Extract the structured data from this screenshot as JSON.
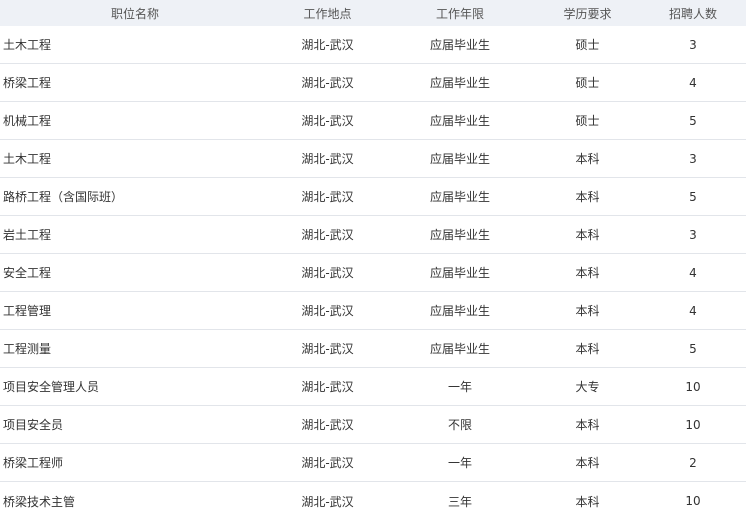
{
  "table": {
    "headers": [
      "职位名称",
      "工作地点",
      "工作年限",
      "学历要求",
      "招聘人数"
    ],
    "rows": [
      [
        "土木工程",
        "湖北-武汉",
        "应届毕业生",
        "硕士",
        "3"
      ],
      [
        "桥梁工程",
        "湖北-武汉",
        "应届毕业生",
        "硕士",
        "4"
      ],
      [
        "机械工程",
        "湖北-武汉",
        "应届毕业生",
        "硕士",
        "5"
      ],
      [
        "土木工程",
        "湖北-武汉",
        "应届毕业生",
        "本科",
        "3"
      ],
      [
        "路桥工程（含国际班）",
        "湖北-武汉",
        "应届毕业生",
        "本科",
        "5"
      ],
      [
        "岩土工程",
        "湖北-武汉",
        "应届毕业生",
        "本科",
        "3"
      ],
      [
        "安全工程",
        "湖北-武汉",
        "应届毕业生",
        "本科",
        "4"
      ],
      [
        "工程管理",
        "湖北-武汉",
        "应届毕业生",
        "本科",
        "4"
      ],
      [
        "工程测量",
        "湖北-武汉",
        "应届毕业生",
        "本科",
        "5"
      ],
      [
        "项目安全管理人员",
        "湖北-武汉",
        "一年",
        "大专",
        "10"
      ],
      [
        "项目安全员",
        "湖北-武汉",
        "不限",
        "本科",
        "10"
      ],
      [
        "桥梁工程师",
        "湖北-武汉",
        "一年",
        "本科",
        "2"
      ],
      [
        "桥梁技术主管",
        "湖北-武汉",
        "三年",
        "本科",
        "10"
      ]
    ]
  }
}
